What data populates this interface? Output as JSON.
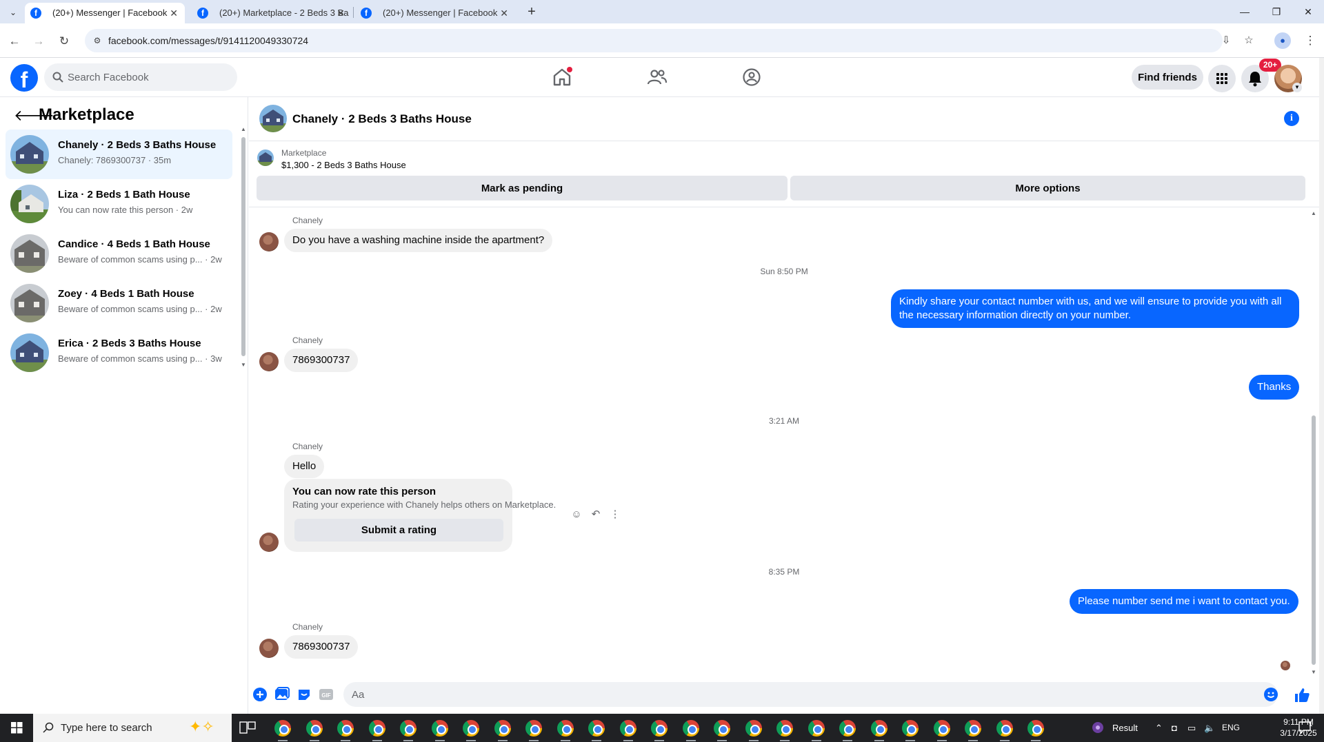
{
  "browser": {
    "tabs": [
      {
        "title": "(20+) Messenger | Facebook",
        "active": true
      },
      {
        "title": "(20+) Marketplace - 2 Beds 3 Ba",
        "active": false
      },
      {
        "title": "(20+) Messenger | Facebook",
        "active": false
      }
    ],
    "url": "facebook.com/messages/t/9141120049330724"
  },
  "fb": {
    "search_placeholder": "Search Facebook",
    "find_friends": "Find friends",
    "notification_badge": "20+"
  },
  "sidebar": {
    "title": "Marketplace",
    "conversations": [
      {
        "name": "Chanely · 2 Beds 3 Baths House",
        "preview": "Chanely: 7869300737 · 35m",
        "active": true
      },
      {
        "name": "Liza · 2 Beds 1 Bath House",
        "preview": "You can now rate this person · 2w",
        "active": false
      },
      {
        "name": "Candice · 4 Beds 1 Bath House",
        "preview": "Beware of common scams using p... · 2w",
        "active": false
      },
      {
        "name": "Zoey · 4 Beds 1 Bath House",
        "preview": "Beware of common scams using p... · 2w",
        "active": false
      },
      {
        "name": "Erica · 2 Beds 3 Baths House",
        "preview": "Beware of common scams using p... · 3w",
        "active": false
      }
    ]
  },
  "chat": {
    "title": "Chanely · 2 Beds 3 Baths House",
    "listing": {
      "label": "Marketplace",
      "price_title": "$1,300 - 2 Beds 3 Baths House",
      "mark_pending": "Mark as pending",
      "more_options": "More options"
    },
    "messages": {
      "m1_sender": "Chanely",
      "m1_text": "Do you have a washing machine inside the apartment?",
      "ts1": "Sun 8:50 PM",
      "m2_text": "Kindly share your contact number with us, and we will ensure to provide you with all the necessary information directly on your number.",
      "m3_sender": "Chanely",
      "m3_text": "7869300737",
      "m4_text": "Thanks",
      "ts2": "3:21 AM",
      "m5_sender": "Chanely",
      "m5_text": "Hello",
      "rate_title": "You can now rate this person",
      "rate_sub": "Rating your experience with Chanely helps others on Marketplace.",
      "rate_button": "Submit a rating",
      "ts3": "8:35 PM",
      "m6_text": "Please number send me i want to contact you.",
      "m7_sender": "Chanely",
      "m7_text": "7869300737"
    },
    "composer_placeholder": "Aa"
  },
  "taskbar": {
    "search_placeholder": "Type here to search",
    "tray_label": "Result",
    "lang": "ENG",
    "time": "9:11 PM",
    "date": "3/17/2025",
    "notif_count": "1"
  }
}
